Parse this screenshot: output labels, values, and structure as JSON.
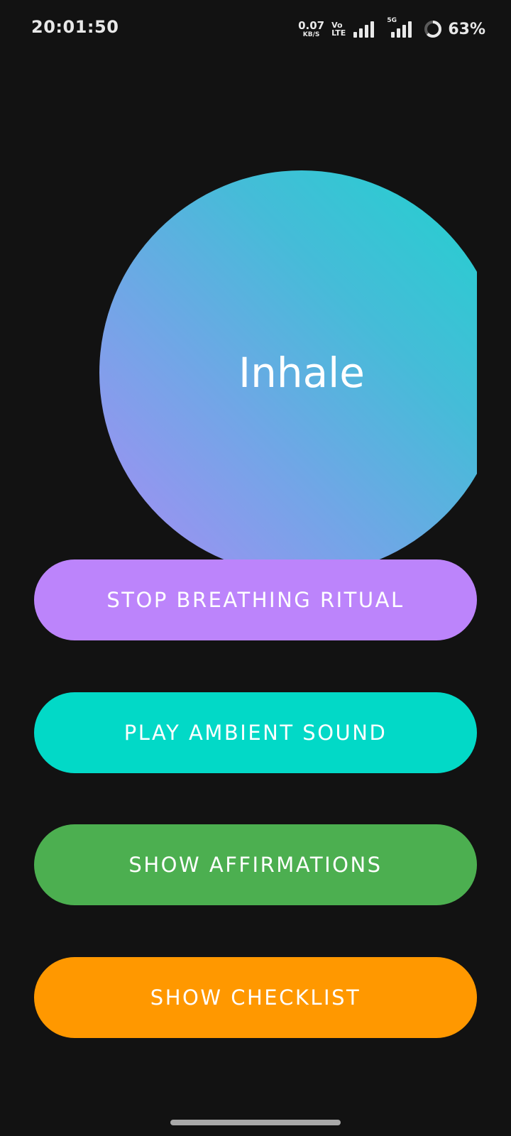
{
  "status_bar": {
    "time": "20:01:50",
    "net_speed_value": "0.07",
    "net_speed_unit": "KB/S",
    "volte_top": "Vo",
    "volte_bottom": "LTE",
    "network_5g": "5G",
    "battery_percent": "63%",
    "icons": [
      "volte-icon",
      "signal-icon",
      "5g-signal-icon",
      "battery-ring-icon"
    ]
  },
  "breathing": {
    "phase_label": "Inhale",
    "colors": [
      "#1fd3ce",
      "#45bcd8",
      "#6fa7e6",
      "#a98cf5"
    ]
  },
  "buttons": {
    "stop_label": "STOP BREATHING RITUAL",
    "ambient_label": "PLAY AMBIENT SOUND",
    "affirmations_label": "SHOW AFFIRMATIONS",
    "checklist_label": "SHOW CHECKLIST"
  },
  "colors": {
    "background": "#121212",
    "stop_button": "#bc84fb",
    "ambient_button": "#02d9c7",
    "affirmations_button": "#4caf50",
    "checklist_button": "#ff9800"
  }
}
